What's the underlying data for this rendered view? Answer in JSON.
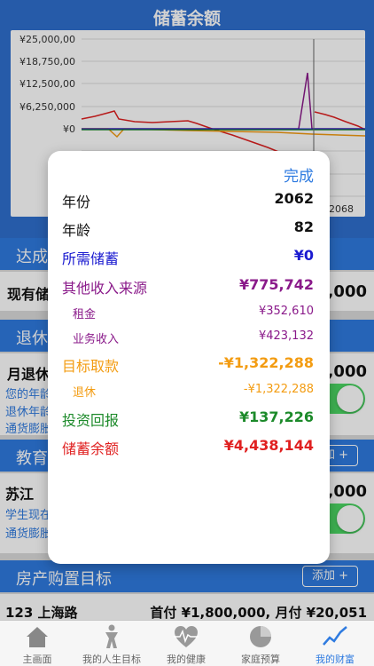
{
  "header": {
    "title": "储蓄余额"
  },
  "chart_data": {
    "type": "line",
    "y_tick_labels": [
      "¥25,000,00",
      "¥18,750,00",
      "¥12,500,00",
      "¥6,250,000",
      "¥0"
    ],
    "x_tick_visible": "2068",
    "series_colors": [
      "#e02020",
      "#8a1a8a",
      "#f39c12",
      "#1c8a2a",
      "#1a1ad0"
    ]
  },
  "sections": {
    "goal": {
      "label": "达成",
      "row_label": "现有储",
      "row_value": ",000"
    },
    "retire": {
      "label": "退休",
      "row_label": "月退休",
      "line1": "您的年龄",
      "line2": "退休年龄",
      "line3": "通货膨胀",
      "row_value": ",000"
    },
    "edu": {
      "label": "教育",
      "add": "加 +",
      "row_label": "苏江",
      "line1": "学生现在",
      "line2": "通货膨胀",
      "row_value": ",000"
    },
    "house": {
      "label": "房产购置目标",
      "add": "添加 +",
      "row_text": "123 上海路",
      "row_value": "首付 ¥1,800,000, 月付 ¥20,051"
    }
  },
  "popup": {
    "done": "完成",
    "rows": [
      {
        "key": "年份",
        "value": "2062"
      },
      {
        "key": "年龄",
        "value": "82"
      },
      {
        "key": "所需储蓄",
        "value": "¥0"
      },
      {
        "key": "其他收入来源",
        "value": "¥775,742"
      },
      {
        "key": "租金",
        "value": "¥352,610"
      },
      {
        "key": "业务收入",
        "value": "¥423,132"
      },
      {
        "key": "目标取款",
        "value": "-¥1,322,288"
      },
      {
        "key": "退休",
        "value": "-¥1,322,288"
      },
      {
        "key": "投资回报",
        "value": "¥137,226"
      },
      {
        "key": "储蓄余额",
        "value": "¥4,438,144"
      }
    ]
  },
  "tabs": [
    {
      "label": "主画面",
      "icon": "home-icon"
    },
    {
      "label": "我的人生目标",
      "icon": "goal-person-icon"
    },
    {
      "label": "我的健康",
      "icon": "health-heart-icon"
    },
    {
      "label": "家庭预算",
      "icon": "budget-pie-icon"
    },
    {
      "label": "我的财富",
      "icon": "wealth-chart-icon"
    }
  ]
}
